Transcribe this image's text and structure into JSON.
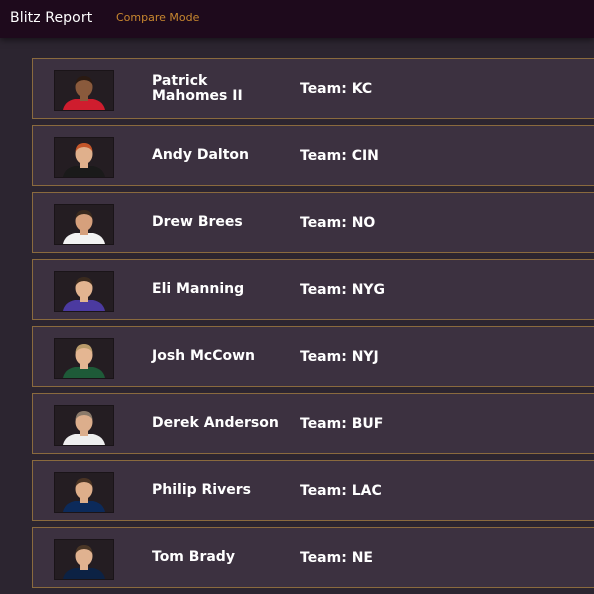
{
  "navbar": {
    "brand": "Blitz Report",
    "compare_link": "Compare Mode"
  },
  "players": [
    {
      "name": "Patrick Mahomes II",
      "team": "Team: KC",
      "jersey": "#cf1d2e",
      "hair": "#2a1a12",
      "skin": "#8a5a3c"
    },
    {
      "name": "Andy Dalton",
      "team": "Team: CIN",
      "jersey": "#1a1a1a",
      "hair": "#c4562a",
      "skin": "#e0b08c"
    },
    {
      "name": "Drew Brees",
      "team": "Team: NO",
      "jersey": "#f2f2f2",
      "hair": "#3a2a1e",
      "skin": "#d6a07c"
    },
    {
      "name": "Eli Manning",
      "team": "Team: NYG",
      "jersey": "#4b3aa0",
      "hair": "#3a2a1e",
      "skin": "#e2b490"
    },
    {
      "name": "Josh McCown",
      "team": "Team: NYJ",
      "jersey": "#1e5a38",
      "hair": "#b89a6a",
      "skin": "#e4b692"
    },
    {
      "name": "Derek Anderson",
      "team": "Team: BUF",
      "jersey": "#eeeeee",
      "hair": "#8a7a6a",
      "skin": "#dcae8c"
    },
    {
      "name": "Philip Rivers",
      "team": "Team: LAC",
      "jersey": "#0c2a5a",
      "hair": "#4a3424",
      "skin": "#deae8a"
    },
    {
      "name": "Tom Brady",
      "team": "Team: NE",
      "jersey": "#0c2244",
      "hair": "#4a3626",
      "skin": "#e0b290"
    }
  ]
}
